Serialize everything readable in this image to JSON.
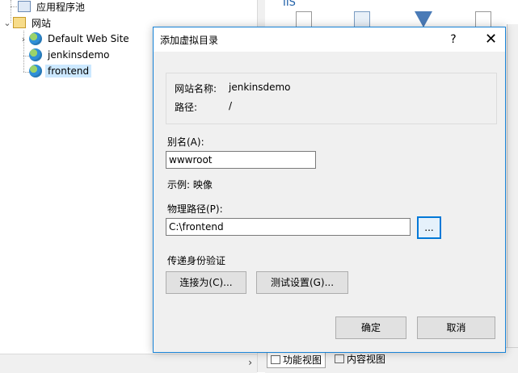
{
  "tree": {
    "app_pools": "应用程序池",
    "sites": "网站",
    "items": [
      "Default Web Site",
      "jenkinsdemo",
      "frontend"
    ]
  },
  "right_pane": {
    "header": "IIS"
  },
  "view_tabs": {
    "features": "功能视图",
    "content": "内容视图"
  },
  "dialog": {
    "title": "添加虚拟目录",
    "help": "?",
    "close": "✕",
    "site_name_label": "网站名称:",
    "site_name_value": "jenkinsdemo",
    "path_label": "路径:",
    "path_value": "/",
    "alias_label": "别名(A):",
    "alias_value": "wwwroot",
    "example": "示例: 映像",
    "physical_path_label": "物理路径(P):",
    "physical_path_value": "C:\\frontend",
    "browse_label": "...",
    "pass_through_label": "传递身份验证",
    "connect_as_label": "连接为(C)...",
    "test_settings_label": "测试设置(G)...",
    "ok_label": "确定",
    "cancel_label": "取消"
  },
  "colors": {
    "accent": "#0078d7",
    "dialog_border": "#1883d7",
    "selection": "#cce8ff"
  }
}
